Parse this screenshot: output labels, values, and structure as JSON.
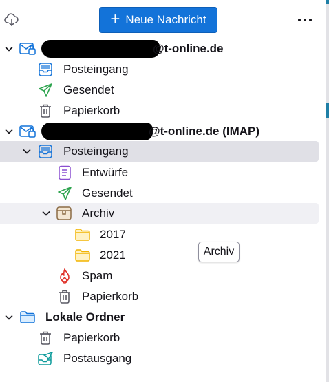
{
  "toolbar": {
    "new_message_label": "Neue Nachricht",
    "cloud_icon": "cloud-download-icon",
    "more_icon": "more-horizontal-icon"
  },
  "accounts": [
    {
      "name_suffix": "@t-online.de",
      "expanded": true,
      "folders": [
        {
          "label": "Posteingang",
          "icon": "inbox-icon"
        },
        {
          "label": "Gesendet",
          "icon": "sent-icon"
        },
        {
          "label": "Papierkorb",
          "icon": "trash-icon"
        }
      ]
    },
    {
      "name_suffix": "@t-online.de (IMAP)",
      "expanded": true,
      "inbox": {
        "label": "Posteingang",
        "selected": true,
        "subfolders": [
          {
            "label": "Entwürfe",
            "icon": "drafts-icon"
          },
          {
            "label": "Gesendet",
            "icon": "sent-icon"
          },
          {
            "label": "Archiv",
            "icon": "archive-icon",
            "expanded": true,
            "subfolders": [
              {
                "label": "2017",
                "icon": "folder-icon"
              },
              {
                "label": "2021",
                "icon": "folder-icon"
              }
            ]
          },
          {
            "label": "Spam",
            "icon": "spam-icon"
          },
          {
            "label": "Papierkorb",
            "icon": "trash-icon"
          }
        ]
      }
    },
    {
      "name": "Lokale Ordner",
      "expanded": true,
      "folders": [
        {
          "label": "Papierkorb",
          "icon": "trash-icon"
        },
        {
          "label": "Postausgang",
          "icon": "outbox-icon"
        }
      ]
    }
  ],
  "tooltip": {
    "text": "Archiv"
  },
  "colors": {
    "accent": "#1373d9",
    "selected_row": "#e0e0e6",
    "sent_green": "#2ea44f",
    "drafts_purple": "#8a4fd0",
    "archive_brown": "#8b6b45",
    "folder_yellow": "#f2b400",
    "spam_red": "#e0332b",
    "outbox_teal": "#0e9c9c",
    "trash_gray": "#5b5b66"
  }
}
